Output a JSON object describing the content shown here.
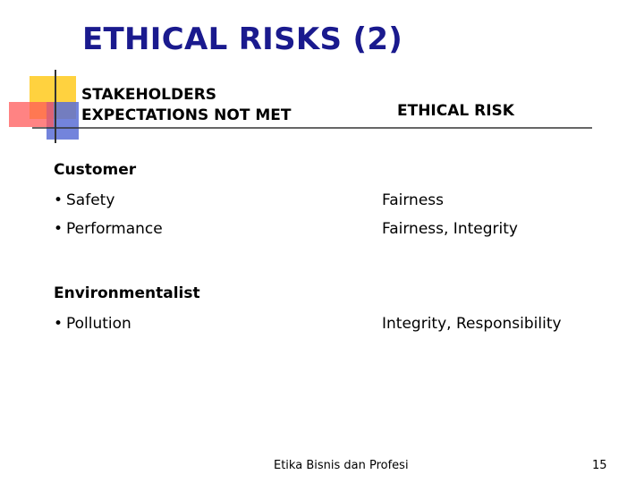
{
  "title": "ETHICAL RISKS (2)",
  "columns": {
    "left_line1": "STAKEHOLDERS",
    "left_line2": "EXPECTATIONS NOT MET",
    "right": "ETHICAL RISK"
  },
  "sections": [
    {
      "name": "Customer",
      "rows": [
        {
          "expectation": "Safety",
          "risk": "Fairness"
        },
        {
          "expectation": "Performance",
          "risk": "Fairness, Integrity"
        }
      ]
    },
    {
      "name": "Environmentalist",
      "rows": [
        {
          "expectation": "Pollution",
          "risk": "Integrity, Responsibility"
        }
      ]
    }
  ],
  "bullet_glyph": "•",
  "footer": {
    "text": "Etika Bisnis dan Profesi",
    "page_number": "15"
  },
  "colors": {
    "title": "#1a1a8e",
    "deco_yellow": "#ffd23f",
    "deco_red": "#ff5a5a",
    "deco_blue": "#5b6fd6"
  }
}
